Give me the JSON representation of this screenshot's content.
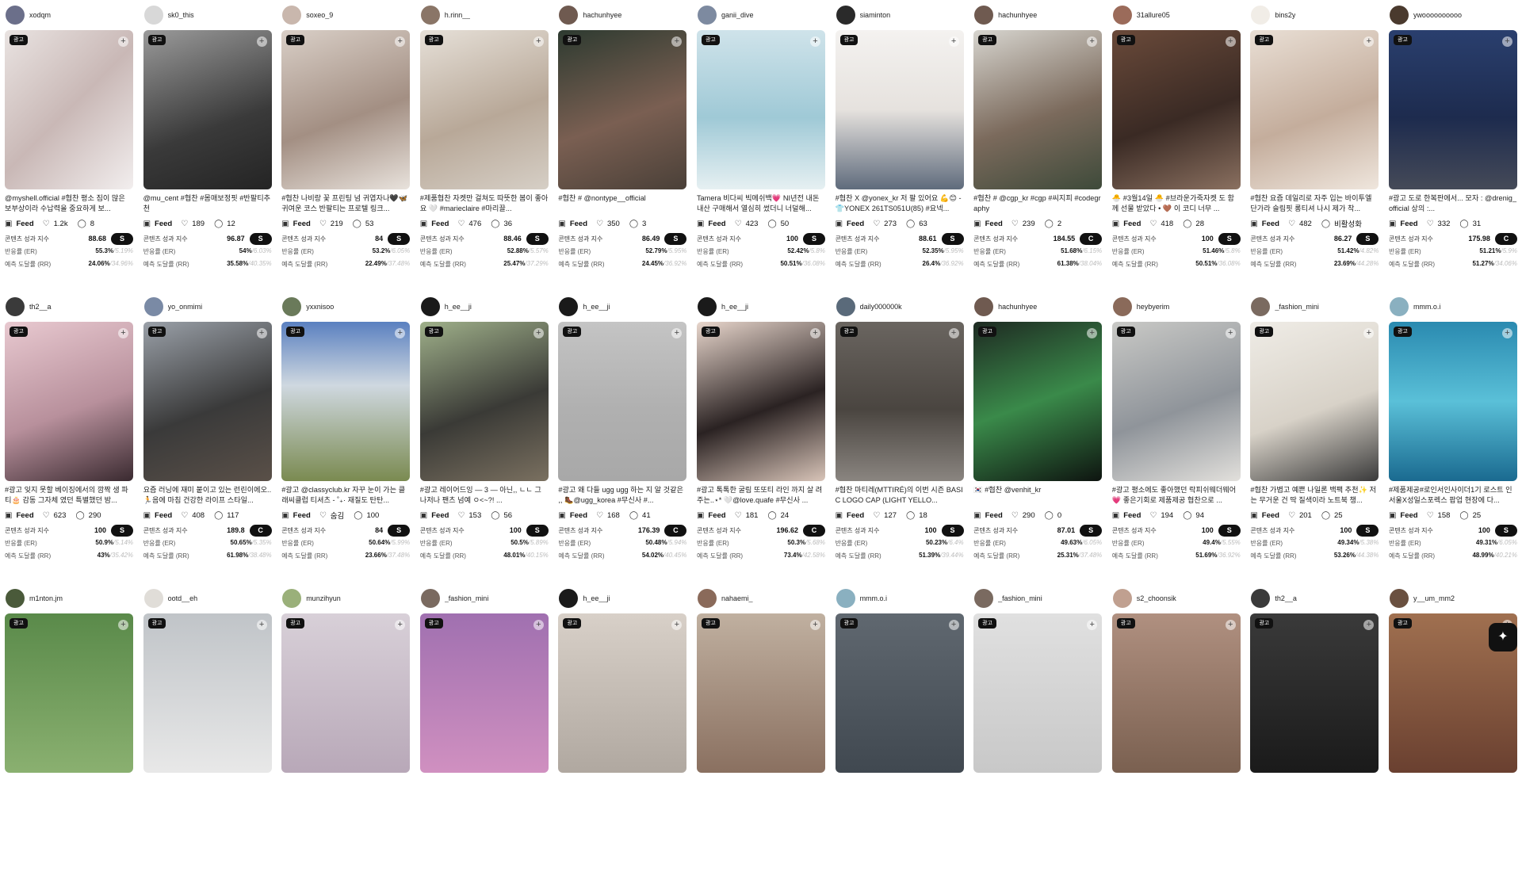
{
  "labels": {
    "ad": "광고",
    "feed": "Feed",
    "score": "콘텐츠 성과 지수",
    "er": "반응률 (ER)",
    "rr": "예측 도달률 (RR)"
  },
  "cards": [
    {
      "user": "xodqm",
      "avatar": "#6b6f8a",
      "bg": "linear-gradient(135deg,#e9e3e1,#c9b8b6 50%,#f2eeee)",
      "caption": "@myshell.official #협찬 평소 짐이 많은 보부상이라 수납력을 중요하게 보...",
      "likes": "1.2k",
      "comments": "8",
      "score": "88.68",
      "grade": "S",
      "er": "55.3%",
      "er_avg": "/5.19%",
      "rr": "24.06%",
      "rr_avg": "/34.96%"
    },
    {
      "user": "sk0_this",
      "avatar": "#d8d8d8",
      "bg": "linear-gradient(160deg,#9a9a9a,#3a3a3a 60%,#242424)",
      "caption": "@mu_cent #협찬 #몸매보정핏 #반팔티추천",
      "likes": "189",
      "comments": "12",
      "score": "96.87",
      "grade": "S",
      "er": "54%",
      "er_avg": "/6.03%",
      "rr": "35.58%",
      "rr_avg": "/40.35%"
    },
    {
      "user": "soxeo_9",
      "avatar": "#c9b7ad",
      "bg": "linear-gradient(160deg,#d9cfc7,#a38f83 55%,#e8e2dc)",
      "caption": "#협찬 나비랑 꽃 프린팅 넘 귀엽자나🖤🦋 귀여운 코스 반팔티는 프로텔 링크...",
      "likes": "219",
      "comments": "53",
      "score": "84",
      "grade": "S",
      "er": "53.2%",
      "er_avg": "/6.05%",
      "rr": "22.49%",
      "rr_avg": "/37.48%"
    },
    {
      "user": "h.rinn__",
      "avatar": "#8a7567",
      "bg": "linear-gradient(160deg,#e6e0d8,#b8a898 55%,#d6cfc6)",
      "caption": "#제품협찬 자켓만 걸쳐도 따뜻한 봄이 좋아요 🤍 #marieclaire #마리끌...",
      "likes": "476",
      "comments": "36",
      "score": "88.46",
      "grade": "S",
      "er": "52.88%",
      "er_avg": "/5.57%",
      "rr": "25.47%",
      "rr_avg": "/37.29%"
    },
    {
      "user": "hachunhyee",
      "avatar": "#6f5a50",
      "bg": "linear-gradient(160deg,#2d3a30,#7a5f52 55%,#4a4038)",
      "caption": "#협찬 # @nontype__official",
      "likes": "350",
      "comments": "3",
      "score": "86.49",
      "grade": "S",
      "er": "52.79%",
      "er_avg": "/5.95%",
      "rr": "24.45%",
      "rr_avg": "/36.92%"
    },
    {
      "user": "ganii_dive",
      "avatar": "#7d8aa0",
      "bg": "linear-gradient(180deg,#cfe3ea,#9fc9d6 55%,#e6f0f2)",
      "caption": "Tamera 비다씨 빅메쉬백💗 NI년전 내돈내산 구매해서 열심히 썼더니 너덜해...",
      "likes": "423",
      "comments": "50",
      "score": "100",
      "grade": "S",
      "er": "52.42%",
      "er_avg": "/5.8%",
      "rr": "50.51%",
      "rr_avg": "/36.08%"
    },
    {
      "user": "siaminton",
      "avatar": "#2a2a2a",
      "bg": "linear-gradient(180deg,#f4f2f0,#e6e2de 50%,#5f6b7c)",
      "caption": "#협찬 X @yonex_kr 저 팔 있어요 💪😊 - 👕YONEX 261TS051U(85) #요넥...",
      "likes": "273",
      "comments": "63",
      "score": "88.61",
      "grade": "S",
      "er": "52.35%",
      "er_avg": "/5.95%",
      "rr": "26.4%",
      "rr_avg": "/36.92%"
    },
    {
      "user": "hachunhyee",
      "avatar": "#6f5a50",
      "bg": "linear-gradient(160deg,#d7d5cf,#7b6a5c 55%,#3e4a3a)",
      "caption": "#협찬 # @cgp_kr #cgp #씨지피 #codegraphy",
      "likes": "239",
      "comments": "2",
      "score": "184.55",
      "grade": "C",
      "er": "51.68%",
      "er_avg": "/6.15%",
      "rr": "61.38%",
      "rr_avg": "/38.04%"
    },
    {
      "user": "31allure05",
      "avatar": "#9b6b5a",
      "bg": "linear-gradient(160deg,#6a4a3a,#3a2a24 55%,#8a7060)",
      "caption": "🐣 #3월14일 🐣 #브라운가죽자켓 도 함께 선물 받았다 • 🤎 이 코디 너무 ...",
      "likes": "418",
      "comments": "28",
      "score": "100",
      "grade": "S",
      "er": "51.46%",
      "er_avg": "/5.8%",
      "rr": "50.51%",
      "rr_avg": "/36.08%"
    },
    {
      "user": "bins2y",
      "avatar": "#f1ede7",
      "bg": "linear-gradient(160deg,#e9dfd5,#c4ad9c 55%,#efe6dd)",
      "caption": "#협찬 요즘 데일리로 자주 입는 바이투엘 단가라 슬림핏 롱티셔 나시 제가 착...",
      "likes": "482",
      "comments": "비활성화",
      "score": "86.27",
      "grade": "S",
      "er": "51.42%",
      "er_avg": "/4.82%",
      "rr": "23.69%",
      "rr_avg": "/44.28%"
    },
    {
      "user": "ywoooooooooo",
      "avatar": "#4a3a2e",
      "bg": "linear-gradient(180deg,#2a3f6e,#1d2b4e 55%,#454a58)",
      "caption": "#광고 도로 한복판에서... 모자 : @drenig_official 상의 :...",
      "likes": "332",
      "comments": "31",
      "score": "175.98",
      "grade": "C",
      "er": "51.21%",
      "er_avg": "/5.9%",
      "rr": "51.27%",
      "rr_avg": "/34.06%"
    },
    {
      "user": "th2__a",
      "avatar": "#3a3a3a",
      "bg": "linear-gradient(160deg,#e8c9d0,#b8909c 55%,#3a2a30)",
      "caption": "#광고 잊지 못할 베이징에서의 깜짝 생 파티🎂 감동 그자체 였던 특별했던 밤...",
      "likes": "623",
      "comments": "290",
      "score": "100",
      "grade": "S",
      "er": "50.9%",
      "er_avg": "/5.14%",
      "rr": "43%",
      "rr_avg": "/35.42%"
    },
    {
      "user": "yo_onmimi",
      "avatar": "#7a8aa5",
      "bg": "linear-gradient(160deg,#9aa0a8,#3a3a3a 55%,#5a5048)",
      "caption": "요즘 러닝에 재미 붙이고 있는 런린이에오..🏃음에 마침 건강한 라이프 스타일...",
      "likes": "408",
      "comments": "117",
      "score": "189.8",
      "grade": "C",
      "er": "50.65%",
      "er_avg": "/5.35%",
      "rr": "61.98%",
      "rr_avg": "/38.48%"
    },
    {
      "user": "yxxnisoo",
      "avatar": "#6a7a5a",
      "bg": "linear-gradient(180deg,#5a80c0,#cfd8e0 40%,#7a8a50)",
      "caption": "#광고 @classyclub.kr 자꾸 눈이 가는 클래씨클럽 티셔츠 - ˚₊· 재질도 탄탄...",
      "likes": "숨김",
      "comments": "100",
      "score": "84",
      "grade": "S",
      "er": "50.64%",
      "er_avg": "/5.99%",
      "rr": "23.66%",
      "rr_avg": "/37.48%"
    },
    {
      "user": "h_ee__ji",
      "avatar": "#1a1a1a",
      "bg": "linear-gradient(160deg,#9fb08a,#3a3a36 55%,#7a7060)",
      "caption": "#광고 레이어드잉 — 3 — 아닌,, ㄴㄴ 그 나저나 팬츠 넘예 ㅇ<~?! ...",
      "likes": "153",
      "comments": "56",
      "score": "100",
      "grade": "S",
      "er": "50.5%",
      "er_avg": "/5.89%",
      "rr": "48.01%",
      "rr_avg": "/40.15%"
    },
    {
      "user": "h_ee__ji",
      "avatar": "#1a1a1a",
      "bg": "linear-gradient(180deg,#c4c4c4,#b0b0b0 55%,#a8a8a8)",
      "caption": "#광고 왜 다들 ugg ugg 하는 지 알 것같은 ,, 🥾@ugg_korea #무신사 #...",
      "likes": "168",
      "comments": "41",
      "score": "176.39",
      "grade": "C",
      "er": "50.48%",
      "er_avg": "/5.94%",
      "rr": "54.02%",
      "rr_avg": "/40.45%"
    },
    {
      "user": "h_ee__ji",
      "avatar": "#1a1a1a",
      "bg": "linear-gradient(160deg,#e8d6cc,#2a2222 55%,#d8c4b8)",
      "caption": "#광고 톡톡한 굴림 또또티 라인 까지 살 려주는..⋆* 🤍@love.quafe #무신사 ...",
      "likes": "181",
      "comments": "24",
      "score": "196.62",
      "grade": "C",
      "er": "50.3%",
      "er_avg": "/5.68%",
      "rr": "73.4%",
      "rr_avg": "/42.58%"
    },
    {
      "user": "daily000000k",
      "avatar": "#5a6a7a",
      "bg": "linear-gradient(180deg,#6a6560,#4a4540 55%,#8a8580)",
      "caption": "#협찬 마티레(MTTIRÉ)의 이번 시즌 BASIC LOGO CAP (LIGHT YELLO...",
      "likes": "127",
      "comments": "18",
      "score": "100",
      "grade": "S",
      "er": "50.23%",
      "er_avg": "/6.4%",
      "rr": "51.39%",
      "rr_avg": "/39.44%"
    },
    {
      "user": "hachunhyee",
      "avatar": "#6f5a50",
      "bg": "linear-gradient(160deg,#1e2a22,#3a8a4a 50%,#0e1410)",
      "caption": "🇰🇷 #협찬 @venhit_kr",
      "likes": "290",
      "comments": "0",
      "score": "87.01",
      "grade": "S",
      "er": "49.63%",
      "er_avg": "/6.05%",
      "rr": "25.31%",
      "rr_avg": "/37.48%"
    },
    {
      "user": "heybyerim",
      "avatar": "#8a6a5a",
      "bg": "linear-gradient(160deg,#c9c9c6,#8f949a 55%,#e2e0dc)",
      "caption": "#광고 평소에도 좋아했던 락피쉬웨더웨어💗 좋은기회로 제품제공 협찬으로 ...",
      "likes": "194",
      "comments": "94",
      "score": "100",
      "grade": "S",
      "er": "49.4%",
      "er_avg": "/5.55%",
      "rr": "51.69%",
      "rr_avg": "/36.92%"
    },
    {
      "user": "_fashion_mini",
      "avatar": "#7a6a60",
      "bg": "linear-gradient(160deg,#efece6,#d8d2c8 55%,#3a3a3a)",
      "caption": "#협찬 가볍고 예쁜 나일론 백팩 추천✨ 저는 무거운 건 딱 질색이라 노트북 챙...",
      "likes": "201",
      "comments": "25",
      "score": "100",
      "grade": "S",
      "er": "49.34%",
      "er_avg": "/5.38%",
      "rr": "53.26%",
      "rr_avg": "/44.38%"
    },
    {
      "user": "mmm.o.i",
      "avatar": "#8ab0c0",
      "bg": "linear-gradient(180deg,#2a8ab0,#5ac0d8 50%,#1a6a90)",
      "caption": "#제품제공#로인서인사이더1기 로스트 인서울X성일스포렉스 팝업 현장에 다...",
      "likes": "158",
      "comments": "25",
      "score": "100",
      "grade": "S",
      "er": "49.31%",
      "er_avg": "/6.05%",
      "rr": "48.99%",
      "rr_avg": "/40.21%"
    },
    {
      "user": "m1nton.jm",
      "avatar": "#4a5a3a",
      "bg": "linear-gradient(180deg,#5a8a4a,#8ab070)"
    },
    {
      "user": "ootd__eh",
      "avatar": "#e0ddd8",
      "bg": "linear-gradient(180deg,#c0c4c8,#e8e8e8)"
    },
    {
      "user": "munzihyun",
      "avatar": "#9ab07a",
      "bg": "linear-gradient(180deg,#d8d0d8,#b8a8b8)"
    },
    {
      "user": "_fashion_mini",
      "avatar": "#7a6a60",
      "bg": "linear-gradient(180deg,#a070b0,#d090c0)"
    },
    {
      "user": "h_ee__ji",
      "avatar": "#1a1a1a",
      "bg": "linear-gradient(180deg,#d8d0c8,#b0a8a0)"
    },
    {
      "user": "nahaemi_",
      "avatar": "#8a6a5a",
      "bg": "linear-gradient(180deg,#c0b0a0,#8a7060)"
    },
    {
      "user": "mmm.o.i",
      "avatar": "#8ab0c0",
      "bg": "linear-gradient(180deg,#606870,#404850)"
    },
    {
      "user": "_fashion_mini",
      "avatar": "#7a6a60",
      "bg": "linear-gradient(180deg,#e0e0e0,#c8c8c8)"
    },
    {
      "user": "s2_choonsik",
      "avatar": "#c0a090",
      "bg": "linear-gradient(180deg,#b09080,#7a6050)"
    },
    {
      "user": "th2__a",
      "avatar": "#3a3a3a",
      "bg": "linear-gradient(180deg,#3a3a3a,#1a1a1a)"
    },
    {
      "user": "y__um_mm2",
      "avatar": "#6a5040",
      "bg": "linear-gradient(180deg,#a07050,#6a4030)"
    }
  ],
  "fab": {
    "icon": "bird-logo-icon",
    "glyph": "✦"
  }
}
